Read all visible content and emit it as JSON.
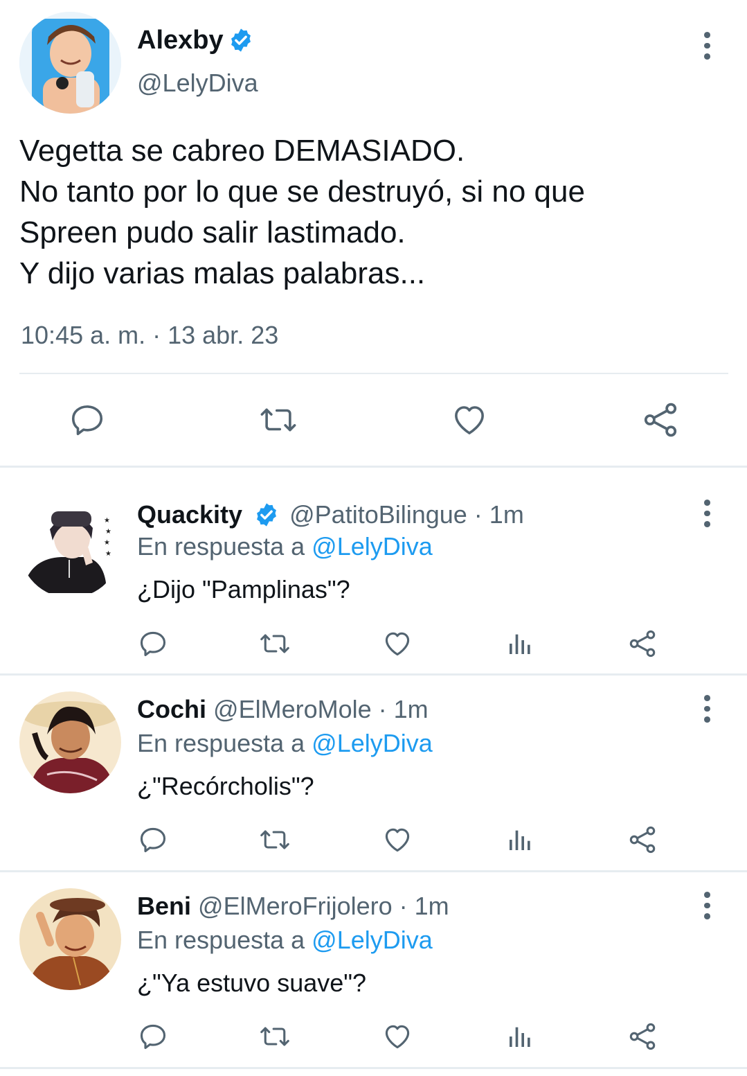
{
  "main_tweet": {
    "author_name": "Alexby",
    "author_handle": "@LelyDiva",
    "verified": true,
    "lines": [
      "Vegetta se cabreo DEMASIADO.",
      "No tanto por lo que se destruyó, si no que",
      "Spreen pudo salir lastimado.",
      "Y dijo varias malas palabras..."
    ],
    "timestamp": "10:45 a. m. · 13 abr. 23",
    "actions": [
      "reply-icon",
      "retweet-icon",
      "like-icon",
      "share-icon"
    ]
  },
  "replies": [
    {
      "name": "Quackity",
      "verified": true,
      "handle_time": "@PatitoBilingue · 1m",
      "reply_prefix": "En respuesta a ",
      "reply_mention": "@LelyDiva",
      "text": "¿Dijo \"Pamplinas\"?"
    },
    {
      "name": "Cochi",
      "verified": false,
      "handle_time": "@ElMeroMole · 1m",
      "reply_prefix": "En respuesta a ",
      "reply_mention": "@LelyDiva",
      "text": "¿\"Recórcholis\"?"
    },
    {
      "name": "Beni",
      "verified": false,
      "handle_time": "@ElMeroFrijolero · 1m",
      "reply_prefix": "En respuesta a ",
      "reply_mention": "@LelyDiva",
      "text": "¿\"Ya estuvo suave\"?"
    }
  ],
  "reply_actions": [
    "reply-icon",
    "retweet-icon",
    "like-icon",
    "analytics-icon",
    "share-icon"
  ],
  "colors": {
    "text": "#0f1419",
    "secondary": "#536471",
    "accent": "#1d9bf0",
    "divider": "#e6ecf0"
  }
}
